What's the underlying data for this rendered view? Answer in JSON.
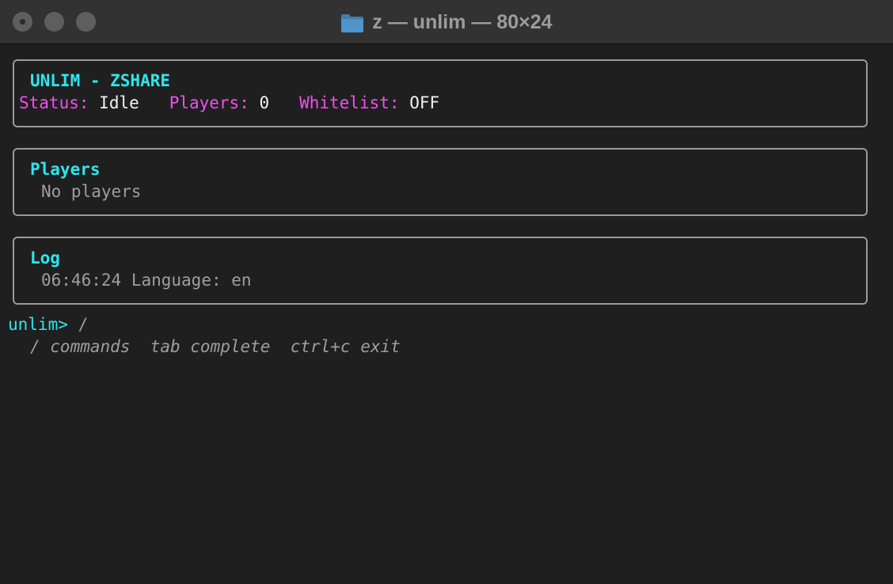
{
  "window": {
    "title": "z — unlim — 80×24",
    "folder_icon": "folder-icon"
  },
  "header_panel": {
    "title": "UNLIM - ZSHARE",
    "status_label": "Status:",
    "status_value": "Idle",
    "players_label": "Players:",
    "players_value": "0",
    "whitelist_label": "Whitelist:",
    "whitelist_value": "OFF"
  },
  "players_panel": {
    "title": "Players",
    "empty_text": "No players"
  },
  "log_panel": {
    "title": "Log",
    "entries": [
      {
        "time": "06:46:24",
        "message": "Language: en"
      }
    ]
  },
  "prompt": {
    "label": "unlim>",
    "input": "/",
    "hint": "/ commands  tab complete  ctrl+c exit"
  },
  "colors": {
    "accent": "#2de6ee",
    "label": "#f24ff0",
    "value": "#f2f2f2",
    "dim": "#9e9e9e"
  }
}
